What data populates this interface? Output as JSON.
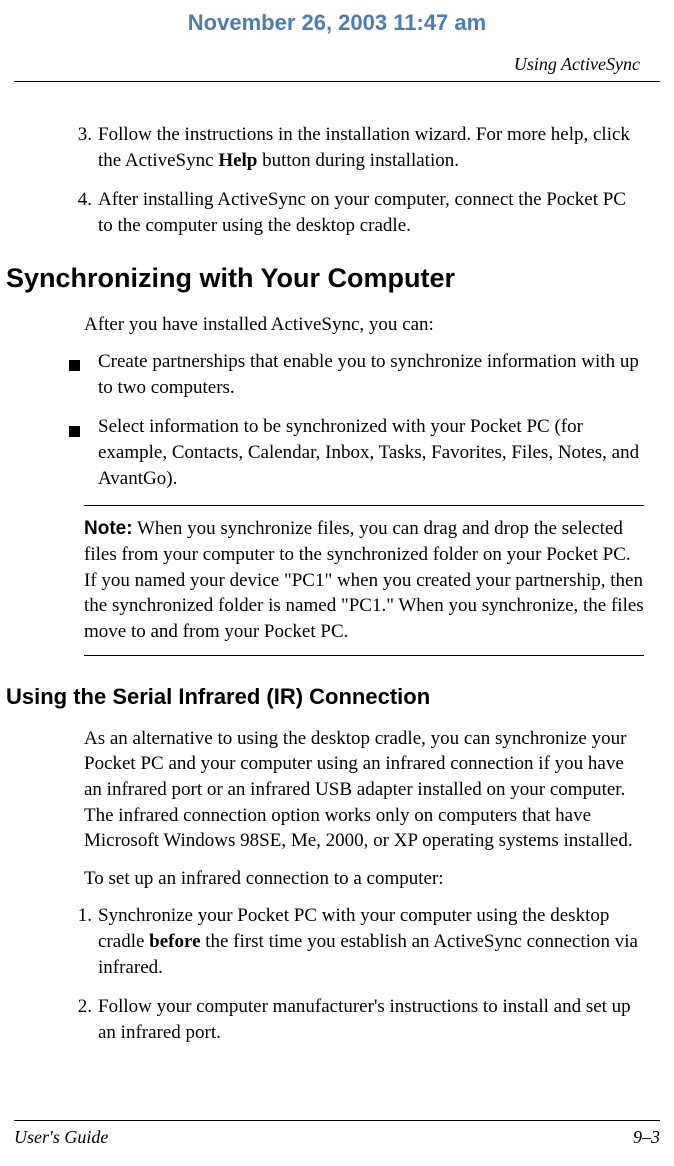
{
  "header": {
    "date": "November 26, 2003 11:47 am",
    "section": "Using ActiveSync"
  },
  "steps1": [
    {
      "num": "3.",
      "text_before": "Follow the instructions in the installation wizard. For more help, click the ActiveSync ",
      "bold": "Help",
      "text_after": " button during installation."
    },
    {
      "num": "4.",
      "text_before": "After installing ActiveSync on your computer, connect the Pocket PC to the computer using the desktop cradle.",
      "bold": "",
      "text_after": ""
    }
  ],
  "h1": "Synchronizing with Your Computer",
  "p1": "After you have installed ActiveSync, you can:",
  "bullets": [
    "Create partnerships that enable you to synchronize information with up to two computers.",
    "Select information to be synchronized with your Pocket PC (for example, Contacts, Calendar, Inbox, Tasks, Favorites, Files, Notes, and AvantGo)."
  ],
  "note": {
    "label": "Note:",
    "text": " When you synchronize files, you can drag and drop the selected files from your computer to the synchronized folder on your Pocket PC. If you named your device \"PC1\" when you created your partnership, then the synchronized folder is named \"PC1.\" When you synchronize, the files move to and from your Pocket PC."
  },
  "h2": "Using the Serial Infrared (IR) Connection",
  "p2": "As an alternative to using the desktop cradle, you can synchronize your Pocket PC and your computer using an infrared connection if you have an infrared port or an infrared USB adapter installed on your computer. The infrared connection option works only on computers that have Microsoft Windows 98SE, Me, 2000, or XP operating systems installed.",
  "p3": "To set up an infrared connection to a computer:",
  "steps2": [
    {
      "num": "1.",
      "text_before": "Synchronize your Pocket PC with your computer using the desktop cradle ",
      "bold": "before",
      "text_after": " the first time you establish an ActiveSync connection via infrared."
    },
    {
      "num": "2.",
      "text_before": "Follow your computer manufacturer's instructions to install and set up an infrared port.",
      "bold": "",
      "text_after": ""
    }
  ],
  "footer": {
    "left": "User's Guide",
    "right": "9–3"
  }
}
